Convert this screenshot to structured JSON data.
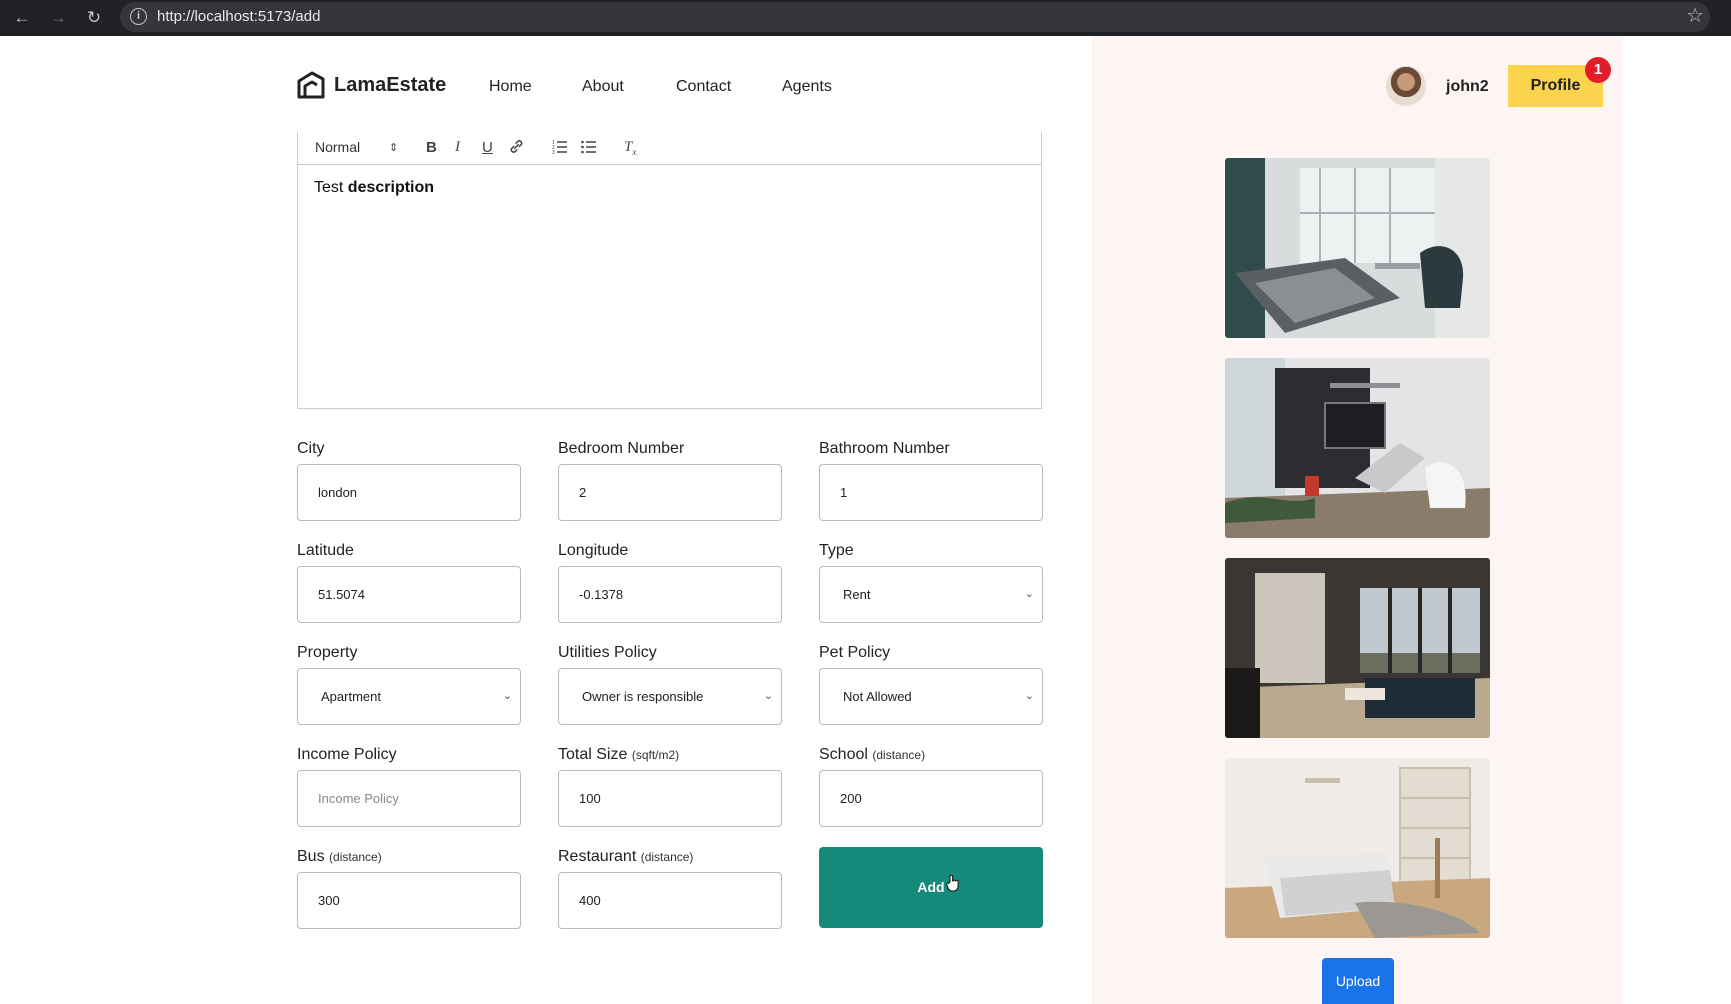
{
  "browser": {
    "url": "http://localhost:5173/add",
    "back_icon": "arrow-left-icon",
    "forward_icon": "arrow-right-icon",
    "reload_icon": "reload-icon",
    "bookmark_icon": "star-icon"
  },
  "nav": {
    "logo_text": "LamaEstate",
    "links": [
      "Home",
      "About",
      "Contact",
      "Agents"
    ],
    "username": "john2",
    "profile_label": "Profile",
    "notification_count": "1"
  },
  "editor": {
    "format_select": "Normal",
    "content_plain": "Test ",
    "content_bold": "description"
  },
  "form": {
    "city": {
      "label": "City",
      "value": "london"
    },
    "bedroom": {
      "label": "Bedroom Number",
      "value": "2"
    },
    "bathroom": {
      "label": "Bathroom Number",
      "value": "1"
    },
    "latitude": {
      "label": "Latitude",
      "value": "51.5074"
    },
    "longitude": {
      "label": "Longitude",
      "value": "-0.1378"
    },
    "type": {
      "label": "Type",
      "value": "Rent"
    },
    "property": {
      "label": "Property",
      "value": "Apartment"
    },
    "utilities": {
      "label": "Utilities Policy",
      "value": "Owner is responsible"
    },
    "pet": {
      "label": "Pet Policy",
      "value": "Not Allowed"
    },
    "income": {
      "label": "Income Policy",
      "placeholder": "Income Policy"
    },
    "size": {
      "label": "Total Size",
      "hint": "(sqft/m2)",
      "value": "100"
    },
    "school": {
      "label": "School",
      "hint": "(distance)",
      "value": "200"
    },
    "bus": {
      "label": "Bus",
      "hint": "(distance)",
      "value": "300"
    },
    "restaurant": {
      "label": "Restaurant",
      "hint": "(distance)",
      "value": "400"
    },
    "submit_label": "Add"
  },
  "sidebar": {
    "upload_label": "Upload"
  },
  "colors": {
    "accent_teal": "#15897a",
    "profile_yellow": "#fcd34d",
    "upload_blue": "#1a73e8",
    "badge_red": "#e11d2b"
  }
}
